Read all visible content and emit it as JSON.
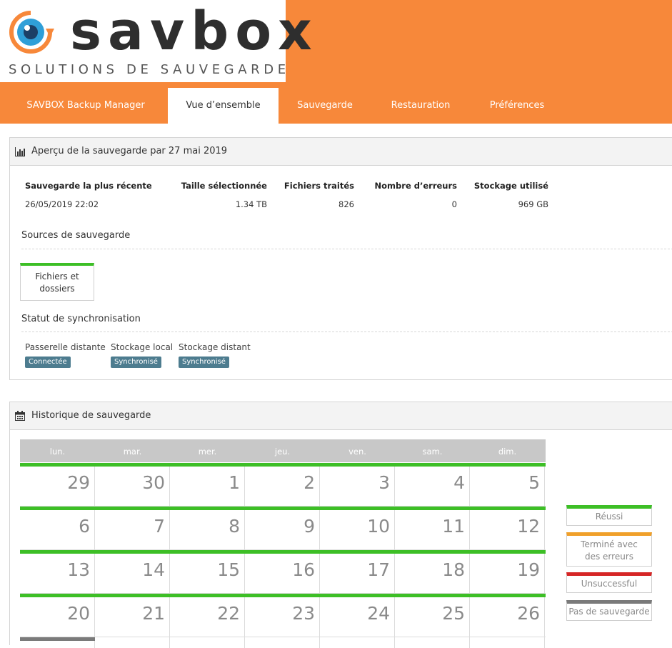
{
  "brand": {
    "name": "savbox",
    "tagline": "SOLUTIONS DE SAUVEGARDE"
  },
  "nav": {
    "items": [
      {
        "label": "SAVBOX Backup Manager",
        "active": false
      },
      {
        "label": "Vue d’ensemble",
        "active": true
      },
      {
        "label": "Sauvegarde",
        "active": false
      },
      {
        "label": "Restauration",
        "active": false
      },
      {
        "label": "Préférences",
        "active": false
      }
    ]
  },
  "overview": {
    "title": "Aperçu de la sauvegarde par 27 mai 2019",
    "stats": {
      "recent_label": "Sauvegarde la plus récente",
      "recent_value": "26/05/2019 22:02",
      "size_label": "Taille sélectionnée",
      "size_value": "1.34 TB",
      "files_label": "Fichiers traités",
      "files_value": "826",
      "errors_label": "Nombre d’erreurs",
      "errors_value": "0",
      "storage_label": "Stockage utilisé",
      "storage_value": "969 GB"
    },
    "sources_title": "Sources de sauvegarde",
    "source_card": "Fichiers et dossiers",
    "sync_title": "Statut de synchronisation",
    "sync": [
      {
        "label": "Passerelle distante",
        "badge": "Connectée"
      },
      {
        "label": "Stockage local",
        "badge": "Synchronisé"
      },
      {
        "label": "Stockage distant",
        "badge": "Synchronisé"
      }
    ]
  },
  "history": {
    "title": "Historique de sauvegarde",
    "weekdays": [
      "lun.",
      "mar.",
      "mer.",
      "jeu.",
      "ven.",
      "sam.",
      "dim."
    ],
    "weeks": [
      [
        "29",
        "30",
        "1",
        "2",
        "3",
        "4",
        "5"
      ],
      [
        "6",
        "7",
        "8",
        "9",
        "10",
        "11",
        "12"
      ],
      [
        "13",
        "14",
        "15",
        "16",
        "17",
        "18",
        "19"
      ],
      [
        "20",
        "21",
        "22",
        "23",
        "24",
        "25",
        "26"
      ]
    ],
    "legend": [
      {
        "label": "Réussi",
        "color": "#3dbf26"
      },
      {
        "label": "Terminé avec des erreurs",
        "color": "#f0a02a"
      },
      {
        "label": "Unsuccessful",
        "color": "#d62626"
      },
      {
        "label": "Pas de sauvegarde",
        "color": "#7a7a7a"
      }
    ]
  },
  "colors": {
    "accent": "#f7883a",
    "success": "#3dbf26",
    "badge": "#4d7c8f"
  }
}
